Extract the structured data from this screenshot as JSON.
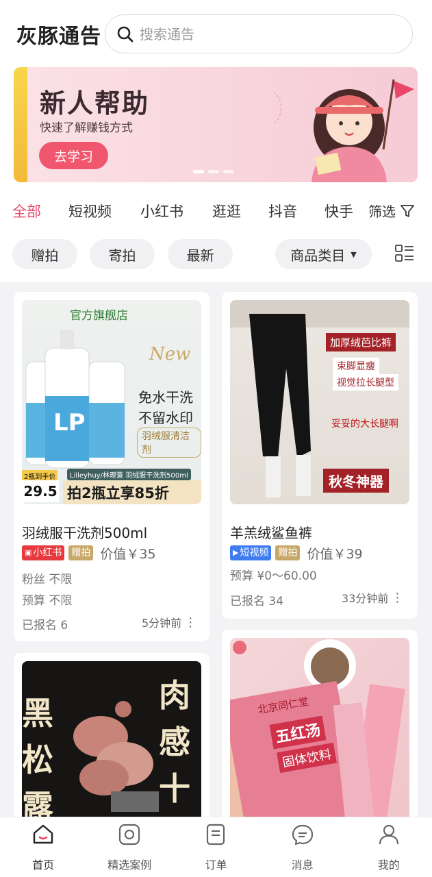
{
  "header": {
    "logo": "灰豚通告",
    "search_placeholder": "搜索通告"
  },
  "banner": {
    "title": "新人帮助",
    "subtitle": "快速了解赚钱方式",
    "button": "去学习"
  },
  "tabs": [
    "全部",
    "短视频",
    "小红书",
    "逛逛",
    "抖音",
    "快手"
  ],
  "filter_label": "筛选",
  "chips": [
    "赠拍",
    "寄拍",
    "最新",
    "商品类目"
  ],
  "cards": [
    {
      "image_text": {
        "store": "官方旗舰店",
        "new": "New",
        "line1": "免水干洗",
        "line2": "不留水印",
        "tag": "羽绒服清洁剂",
        "promo": "拍2瓶立享85折",
        "price": "29.5",
        "brand": "Lilleyhuy/林理薏  羽绒服干洗剂500ml",
        "left_note": "2瓶到手价"
      },
      "title": "羽绒服干洗剂500ml",
      "platform": "小红书",
      "type": "赠拍",
      "value": "价值￥35",
      "fans": "粉丝 不限",
      "budget": "预算 不限",
      "signed": "已报名 6",
      "time": "5分钟前"
    },
    {
      "image_text": {
        "l1": "加厚绒芭比裤",
        "l2": "束脚显瘦",
        "l3": "视觉拉长腿型",
        "l4": "妥妥的大长腿啊",
        "l5": "秋冬神器"
      },
      "title": "羊羔绒鲨鱼裤",
      "platform": "短视频",
      "type": "赠拍",
      "value": "价值￥39",
      "budget": "预算 ¥0～60.00",
      "signed": "已报名 34",
      "time": "33分钟前"
    },
    {
      "image_text": {
        "t1": "黑",
        "t2": "松",
        "t3": "露",
        "t4": "肉",
        "t5": "感",
        "t6": "十"
      }
    },
    {
      "image_text": {
        "brand": "北京同仁堂",
        "p1": "五红汤",
        "p2": "固体饮料"
      }
    }
  ],
  "nav": [
    "首页",
    "精选案例",
    "订单",
    "消息",
    "我的"
  ],
  "colors": {
    "accent": "#e8476a",
    "banner_btn": "#f0576e"
  }
}
